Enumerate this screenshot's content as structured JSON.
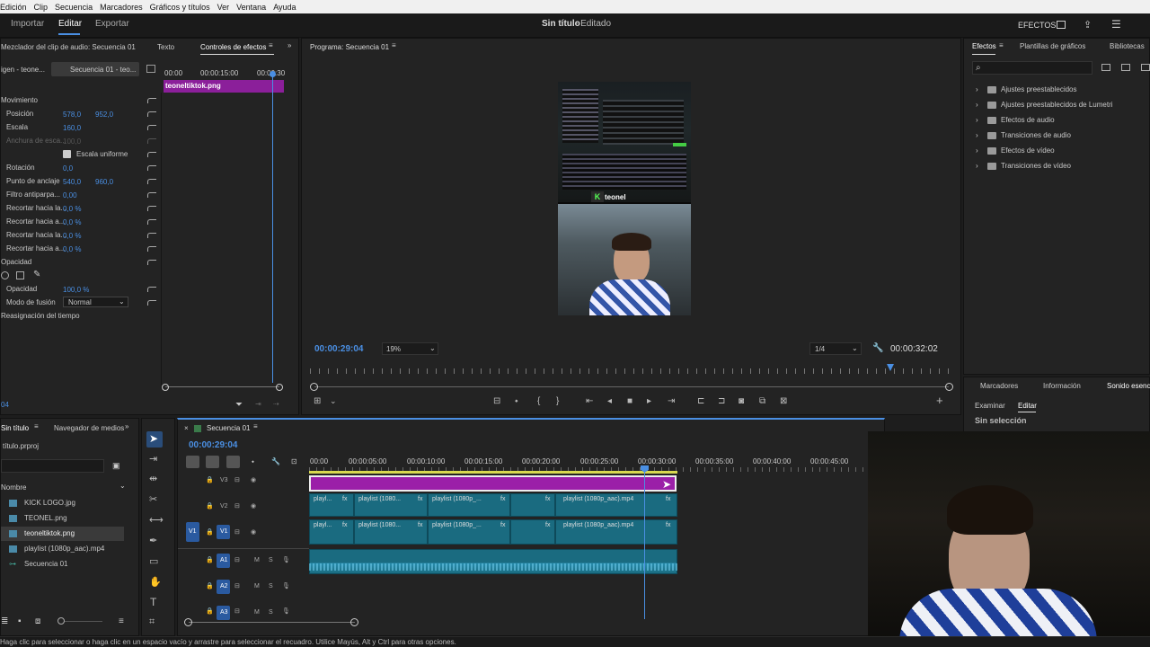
{
  "menu": [
    "Edición",
    "Clip",
    "Secuencia",
    "Marcadores",
    "Gráficos y títulos",
    "Ver",
    "Ventana",
    "Ayuda"
  ],
  "header": {
    "tabs": [
      "Importar",
      "Editar",
      "Exportar"
    ],
    "active": "Editar",
    "title": "Sin título",
    "title_suffix": " - Editado",
    "effects_label": "EFECTOS"
  },
  "source_panel": {
    "tabs": [
      "Mezclador del clip de audio: Secuencia 01",
      "Texto",
      "Controles de efectos"
    ],
    "source": "igen - teone...",
    "sequence": "Secuencia 01 - teo...",
    "ruler": [
      "00:00",
      "00:00:15:00",
      "00:00:30"
    ],
    "clip_name": "teoneltiktok.png",
    "rows": [
      {
        "label": "Movimiento",
        "v1": "",
        "v2": ""
      },
      {
        "label": "Posición",
        "v1": "578,0",
        "v2": "952,0"
      },
      {
        "label": "Escala",
        "v1": "160,0",
        "v2": ""
      },
      {
        "label": "Anchura de esca...",
        "v1": "100,0",
        "v2": ""
      },
      {
        "label": "Escala uniforme",
        "v1": "",
        "v2": ""
      },
      {
        "label": "Rotación",
        "v1": "0,0",
        "v2": ""
      },
      {
        "label": "Punto de anclaje",
        "v1": "540,0",
        "v2": "960,0"
      },
      {
        "label": "Filtro antiparpa...",
        "v1": "0,00",
        "v2": ""
      },
      {
        "label": "Recortar hacia la...",
        "v1": "0,0 %",
        "v2": ""
      },
      {
        "label": "Recortar hacia a...",
        "v1": "0,0 %",
        "v2": ""
      },
      {
        "label": "Recortar hacia la...",
        "v1": "0,0 %",
        "v2": ""
      },
      {
        "label": "Recortar hacia a...",
        "v1": "0,0 %",
        "v2": ""
      },
      {
        "label": "Opacidad",
        "v1": "",
        "v2": ""
      }
    ],
    "opacity_label": "Opacidad",
    "opacity_val": "100,0 %",
    "blend_label": "Modo de fusión",
    "blend_val": "Normal",
    "time_remap": "Reasignación del tiempo",
    "bottom_time": "04"
  },
  "program": {
    "title": "Programa: Secuencia 01",
    "timecode": "00:00:29:04",
    "zoom": "19%",
    "quality": "1/4",
    "duration": "00:00:32:02",
    "overlay_text": "teonel"
  },
  "effects": {
    "tabs": [
      "Efectos",
      "Plantillas de gráficos",
      "Bibliotecas"
    ],
    "items": [
      "Ajustes preestablecidos",
      "Ajustes preestablecidos de Lumetri",
      "Efectos de audio",
      "Transiciones de audio",
      "Efectos de vídeo",
      "Transiciones de vídeo"
    ]
  },
  "essential_sound": {
    "tabs": [
      "Marcadores",
      "Información",
      "Sonido esencial"
    ],
    "sub": [
      "Examinar",
      "Editar"
    ],
    "status": "Sin selección"
  },
  "project": {
    "tabs": [
      "Sin título",
      "Navegador de medios"
    ],
    "file": "título.prproj",
    "col": "Nombre",
    "items": [
      "KICK LOGO.jpg",
      "TEONEL.png",
      "teoneltiktok.png",
      "playlist (1080p_aac).mp4",
      "Secuencia 01"
    ]
  },
  "timeline": {
    "tab": "Secuencia 01",
    "timecode": "00:00:29:04",
    "ruler": [
      "00:00",
      "00:00:05:00",
      "00:00:10:00",
      "00:00:15:00",
      "00:00:20:00",
      "00:00:25:00",
      "00:00:30:00",
      "00:00:35:00",
      "00:00:40:00",
      "00:00:45:00"
    ],
    "tracks": [
      "V3",
      "V2",
      "V1",
      "A1",
      "A2",
      "A3"
    ],
    "clip_label": "playlist (1080p_aac).mp4",
    "clip_short": "playl...",
    "clip_mid": "playlist (1080...",
    "clip_mid2": "playlist (1080p_..."
  },
  "status_bar": "Haga clic para seleccionar o haga clic en un espacio vacío y arrastre para seleccionar el recuadro. Utilice Mayús, Alt y Ctrl para otras opciones.",
  "colors": {
    "accent": "#4a8fe3",
    "clip_video": "#1a6b80",
    "clip_graphic": "#9b1fa8"
  }
}
